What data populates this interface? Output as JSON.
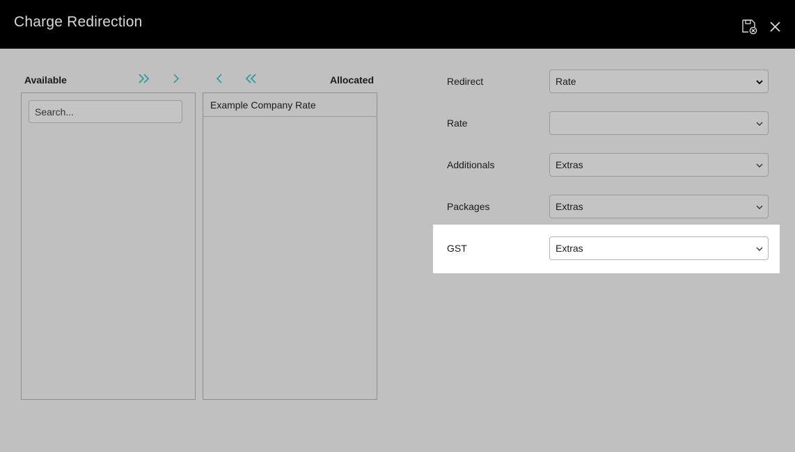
{
  "header": {
    "title": "Charge Redirection",
    "icons": {
      "save_close": "save-close-icon",
      "close": "close-icon"
    }
  },
  "transfer": {
    "available_label": "Available",
    "allocated_label": "Allocated",
    "search_placeholder": "Search...",
    "search_value": "",
    "available_items": [],
    "allocated_items": [
      {
        "label": "Example Company Rate"
      }
    ],
    "accent_color": "#2a9a9a"
  },
  "form": {
    "rows": [
      {
        "label": "Redirect",
        "value": "Rate"
      },
      {
        "label": "Rate",
        "value": ""
      },
      {
        "label": "Additionals",
        "value": "Extras"
      },
      {
        "label": "Packages",
        "value": "Extras"
      },
      {
        "label": "GST",
        "value": "Extras"
      }
    ],
    "highlighted_row": "GST"
  }
}
